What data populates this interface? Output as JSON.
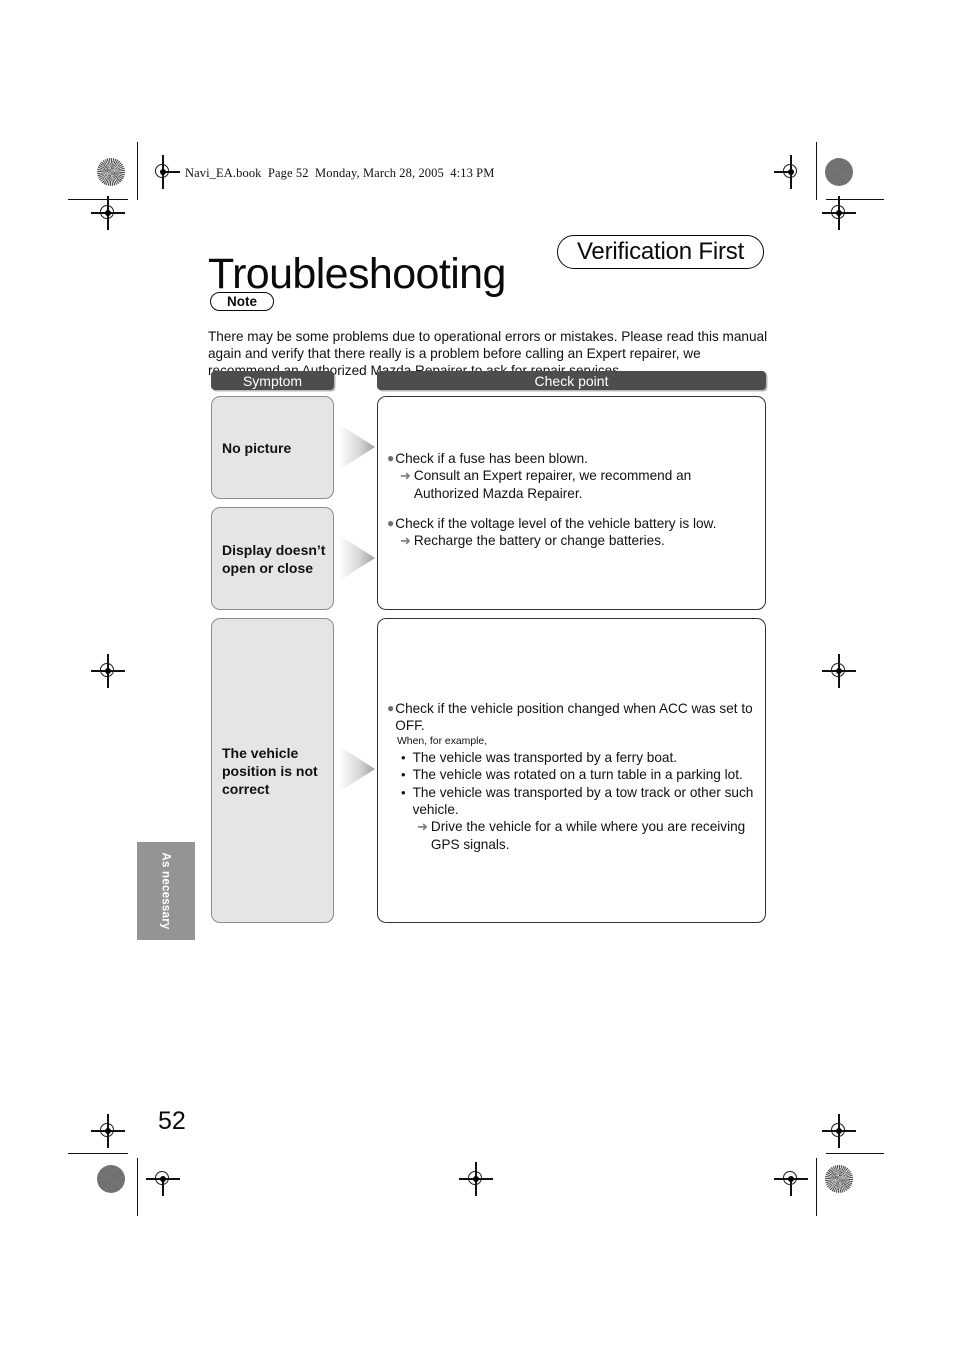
{
  "header": {
    "book_line": "Navi_EA.book  Page 52  Monday, March 28, 2005  4:13 PM"
  },
  "page": {
    "title": "Troubleshooting",
    "badge": "Verification First",
    "note_label": "Note",
    "intro": "There may be some problems due to operational errors or mistakes. Please read this manual again and verify that there really is a problem before calling an Expert repairer, we recommend an Authorized Mazda Repairer to ask for repair services.",
    "side_tab": "As necessary",
    "page_number": "52"
  },
  "table": {
    "headers": {
      "symptom": "Symptom",
      "checkpoint": "Check point"
    },
    "symptoms": [
      {
        "label": "No picture"
      },
      {
        "label": "Display doesn’t open or close"
      },
      {
        "label": "The vehicle position is not correct"
      }
    ],
    "checkpoints": {
      "block1": {
        "check": "Check if a fuse has been blown.",
        "action": "Consult an Expert repairer, we recommend an Authorized Mazda Repairer."
      },
      "block2": {
        "check": "Check if the voltage level of the vehicle battery is low.",
        "action": "Recharge the battery or change batteries."
      },
      "block3": {
        "check": "Check if the vehicle position changed when ACC was set to OFF.",
        "note": "When, for example,",
        "examples": [
          "The vehicle was transported by a ferry boat.",
          "The vehicle was rotated on a turn table in a parking lot.",
          "The vehicle was transported by a tow track or other such vehicle."
        ],
        "action": "Drive the vehicle for a while where you are receiving GPS signals."
      }
    }
  },
  "glyphs": {
    "dot": "●",
    "arrow": "➜",
    "bullet": "•"
  },
  "colors": {
    "header_bar": "#4d4d4d",
    "symptom_fill": "#e5e5e5",
    "side_tab": "#949494",
    "marker_gray": "#6e6e6e"
  }
}
